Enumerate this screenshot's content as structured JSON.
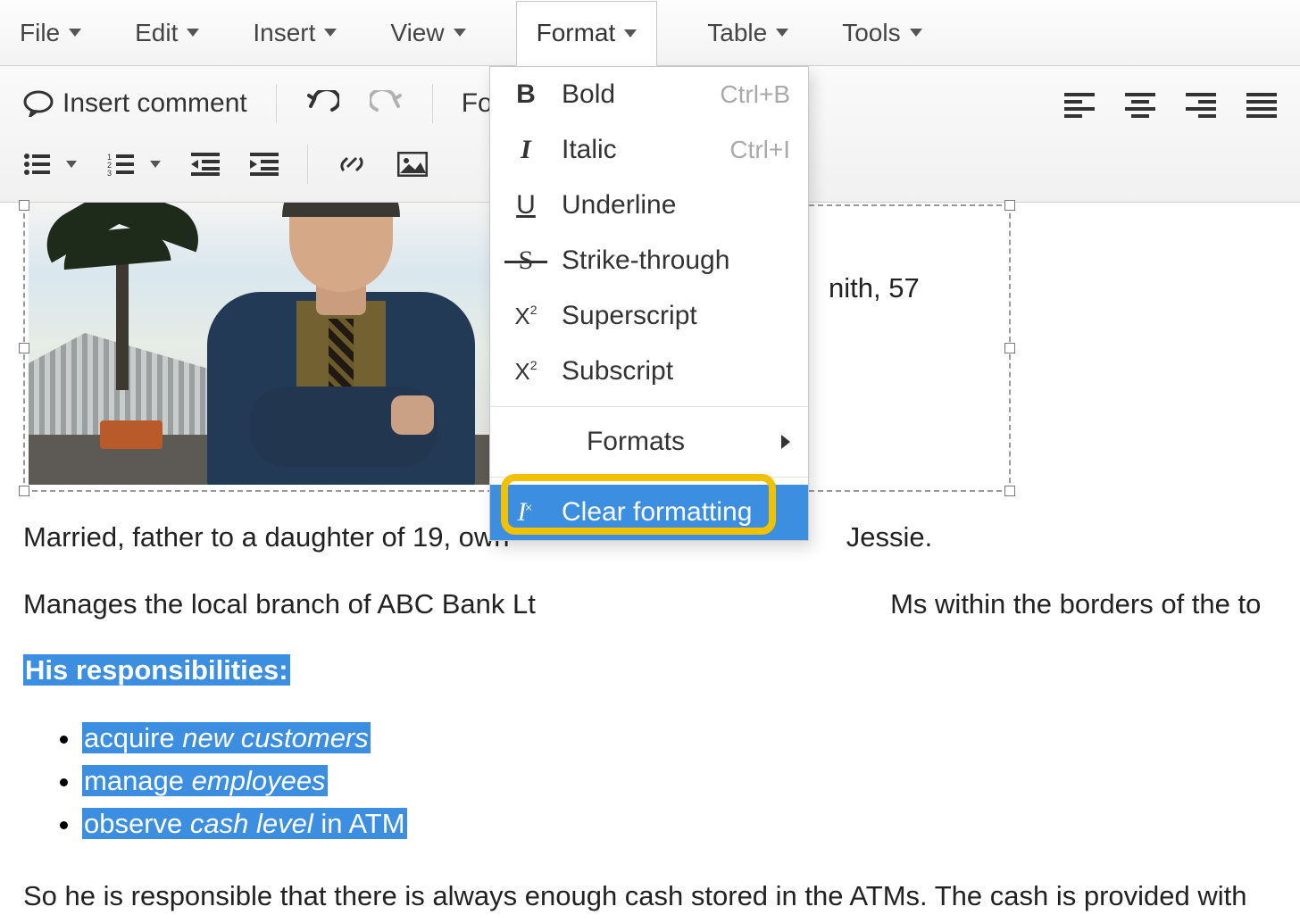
{
  "menubar": {
    "file": "File",
    "edit": "Edit",
    "insert": "Insert",
    "view": "View",
    "format": "Format",
    "table": "Table",
    "tools": "Tools"
  },
  "toolbar": {
    "insert_comment": "Insert comment",
    "fo_fragment": "Fo"
  },
  "format_menu": {
    "bold": {
      "label": "Bold",
      "shortcut": "Ctrl+B"
    },
    "italic": {
      "label": "Italic",
      "shortcut": "Ctrl+I"
    },
    "underline": {
      "label": "Underline"
    },
    "strike": {
      "label": "Strike-through"
    },
    "superscript": {
      "label": "Superscript"
    },
    "subscript": {
      "label": "Subscript"
    },
    "formats": {
      "label": "Formats"
    },
    "clear": {
      "label": "Clear formatting"
    }
  },
  "doc": {
    "side_text": "nith, 57",
    "p1_left": "Married, father to a daughter of 19, own",
    "p1_right": "Jessie.",
    "p2_left": "Manages the local branch of ABC Bank Lt",
    "p2_right": "Ms within the borders of the to",
    "heading_sel": "His responsibilities:",
    "li1_a": "acquire ",
    "li1_b": "new customers",
    "li2_a": "manage ",
    "li2_b": "employees",
    "li3_a": "observe ",
    "li3_b": "cash level",
    "li3_c": " in ATM",
    "p3": "So he is responsible that there is always enough cash stored in the ATMs. The cash is provided with"
  }
}
